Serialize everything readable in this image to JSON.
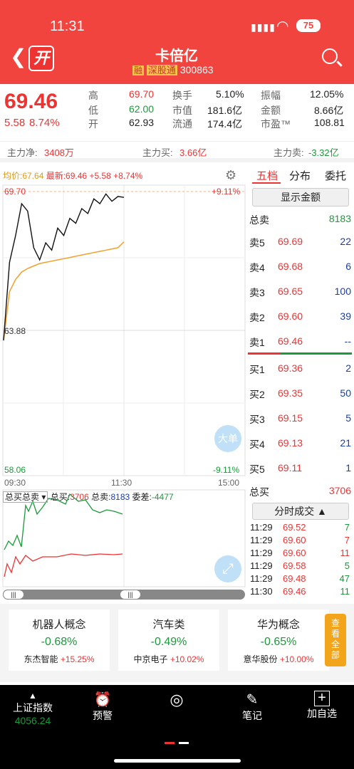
{
  "status_bar": {
    "time": "11:31",
    "battery": "75"
  },
  "header": {
    "title": "卡倍亿",
    "badge_rong": "融",
    "badge_sgt": "深股通",
    "code": "300863",
    "open_icon_label": "开"
  },
  "quote": {
    "price": "69.46",
    "change": "5.58",
    "change_pct": "8.74%",
    "stats": [
      {
        "label": "高",
        "value": "69.70",
        "color": "red"
      },
      {
        "label": "换手",
        "value": "5.10%",
        "color": "black"
      },
      {
        "label": "振幅",
        "value": "12.05%",
        "color": "black"
      },
      {
        "label": "低",
        "value": "62.00",
        "color": "green"
      },
      {
        "label": "市值",
        "value": "181.6亿",
        "color": "black"
      },
      {
        "label": "金额",
        "value": "8.66亿",
        "color": "black"
      },
      {
        "label": "开",
        "value": "62.93",
        "color": "black"
      },
      {
        "label": "流通",
        "value": "174.4亿",
        "color": "black"
      },
      {
        "label": "市盈™",
        "value": "108.81",
        "color": "black"
      }
    ]
  },
  "mainflow": {
    "net_label": "主力净:",
    "net_value": "3408万",
    "buy_label": "主力买:",
    "buy_value": "3.66亿",
    "sell_label": "主力卖:",
    "sell_value": "-3.32亿"
  },
  "chart": {
    "avg_label": "均价:67.64",
    "latest_label": "最新:69.46",
    "chg": "+5.58",
    "chg_pct": "+8.74%",
    "y_high": "69.70",
    "y_mid": "63.88",
    "y_low": "58.06",
    "pct_high": "+9.11%",
    "pct_low": "-9.11%",
    "t_start": "09:30",
    "t_mid": "11:30",
    "t_end": "15:00",
    "dadan_label": "大单",
    "sub_select": "总买总卖",
    "sub_buy_label": "总买:",
    "sub_buy": "3706",
    "sub_sell_label": "总卖:",
    "sub_sell": "8183",
    "sub_diff_label": "委差:",
    "sub_diff": "-4477"
  },
  "chart_data": {
    "type": "line",
    "title": "",
    "series": [
      {
        "name": "最新",
        "values": [
          63.6,
          66.8,
          67.9,
          69.2,
          68.9,
          67.4,
          66.9,
          67.6,
          67.3,
          68.2,
          67.9,
          68.6,
          68.4,
          69.0,
          68.8,
          69.4,
          69.2,
          69.6,
          69.3,
          69.5,
          69.46
        ]
      },
      {
        "name": "均价",
        "values": [
          63.6,
          65.6,
          66.1,
          66.4,
          66.55,
          66.65,
          66.75,
          66.8,
          66.85,
          66.9,
          66.95,
          67.0,
          67.05,
          67.1,
          67.15,
          67.2,
          67.25,
          67.3,
          67.35,
          67.4,
          67.64
        ]
      }
    ],
    "ylim": [
      58.06,
      69.7
    ]
  },
  "book": {
    "tabs": [
      "五档",
      "分布",
      "委托"
    ],
    "show_amount": "显示金额",
    "total_sell_label": "总卖",
    "total_sell": "8183",
    "sells": [
      {
        "label": "卖5",
        "price": "69.69",
        "vol": "22"
      },
      {
        "label": "卖4",
        "price": "69.68",
        "vol": "6"
      },
      {
        "label": "卖3",
        "price": "69.65",
        "vol": "100"
      },
      {
        "label": "卖2",
        "price": "69.60",
        "vol": "39"
      },
      {
        "label": "卖1",
        "price": "69.46",
        "vol": "--"
      }
    ],
    "buys": [
      {
        "label": "买1",
        "price": "69.36",
        "vol": "2"
      },
      {
        "label": "买2",
        "price": "69.35",
        "vol": "50"
      },
      {
        "label": "买3",
        "price": "69.15",
        "vol": "5"
      },
      {
        "label": "买4",
        "price": "69.13",
        "vol": "21"
      },
      {
        "label": "买5",
        "price": "69.11",
        "vol": "1"
      }
    ],
    "total_buy_label": "总买",
    "total_buy": "3706",
    "trades_btn": "分时成交 ▲",
    "trades": [
      {
        "t": "11:29",
        "p": "69.52",
        "v": "7",
        "pc": "red",
        "vc": "green"
      },
      {
        "t": "11:29",
        "p": "69.60",
        "v": "7",
        "pc": "red",
        "vc": "red"
      },
      {
        "t": "11:29",
        "p": "69.60",
        "v": "11",
        "pc": "red",
        "vc": "red"
      },
      {
        "t": "11:29",
        "p": "69.58",
        "v": "5",
        "pc": "red",
        "vc": "green"
      },
      {
        "t": "11:29",
        "p": "69.48",
        "v": "47",
        "pc": "red",
        "vc": "green"
      },
      {
        "t": "11:30",
        "p": "69.46",
        "v": "11",
        "pc": "red",
        "vc": "green"
      }
    ]
  },
  "concepts": [
    {
      "name": "机器人概念",
      "pct": "-0.68%",
      "lead": "东杰智能",
      "lead_pct": "+15.25%"
    },
    {
      "name": "汽车类",
      "pct": "-0.49%",
      "lead": "中京电子",
      "lead_pct": "+10.02%"
    },
    {
      "name": "华为概念",
      "pct": "-0.65%",
      "lead": "意华股份",
      "lead_pct": "+10.00%"
    }
  ],
  "view_all": "查看全部",
  "tabbar": {
    "index_name": "上证指数",
    "index_value": "4056.24",
    "alert": "预警",
    "notes": "笔记",
    "add": "加自选"
  }
}
